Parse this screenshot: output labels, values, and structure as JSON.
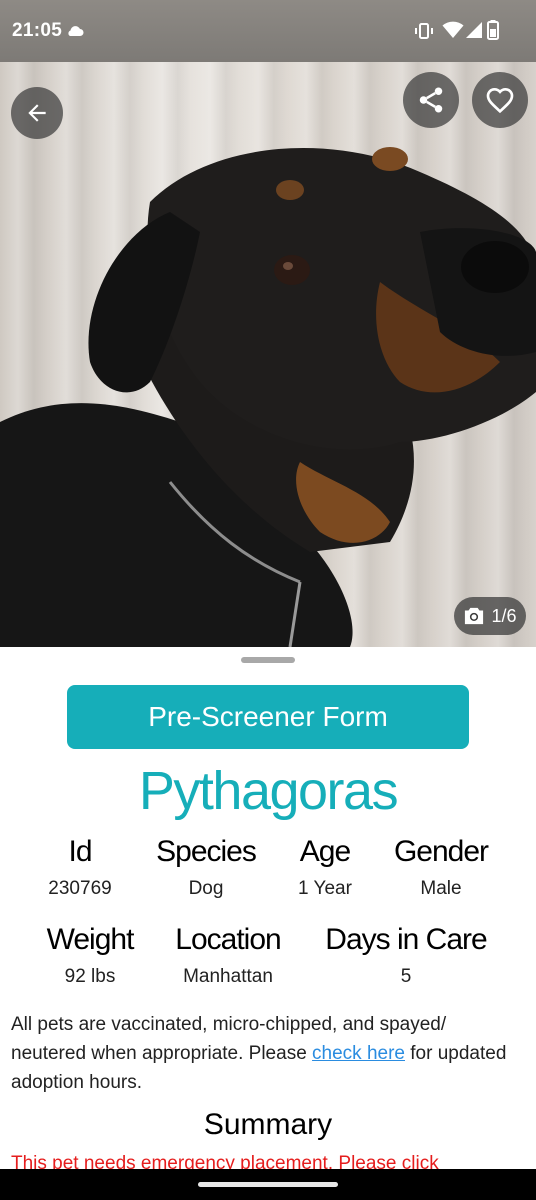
{
  "status_bar": {
    "time": "21:05",
    "icons": [
      "cloud-icon",
      "vibrate-icon",
      "wifi-icon",
      "signal-icon",
      "battery-icon"
    ]
  },
  "hero": {
    "photo_counter": "1/6",
    "icons": [
      "back-arrow-icon",
      "share-icon",
      "heart-icon",
      "camera-icon"
    ]
  },
  "actions": {
    "prescreener_label": "Pre-Screener Form"
  },
  "pet": {
    "name": "Pythagoras",
    "attributes_row1": [
      {
        "label": "Id",
        "value": "230769"
      },
      {
        "label": "Species",
        "value": "Dog"
      },
      {
        "label": "Age",
        "value": "1 Year"
      },
      {
        "label": "Gender",
        "value": "Male"
      }
    ],
    "attributes_row2": [
      {
        "label": "Weight",
        "value": "92 lbs"
      },
      {
        "label": "Location",
        "value": "Manhattan"
      },
      {
        "label": "Days in Care",
        "value": "5"
      }
    ]
  },
  "notice": {
    "text_before": "All pets are vaccinated, micro-chipped, and spayed/ neutered when appropriate. Please ",
    "link": "check here",
    "text_after": " for updated adoption hours."
  },
  "summary": {
    "title": "Summary",
    "urgent_text": "This pet needs emergency placement. Please click"
  },
  "colors": {
    "accent": "#16aeb9",
    "link": "#2a8ce0",
    "urgent": "#e51d1d"
  }
}
